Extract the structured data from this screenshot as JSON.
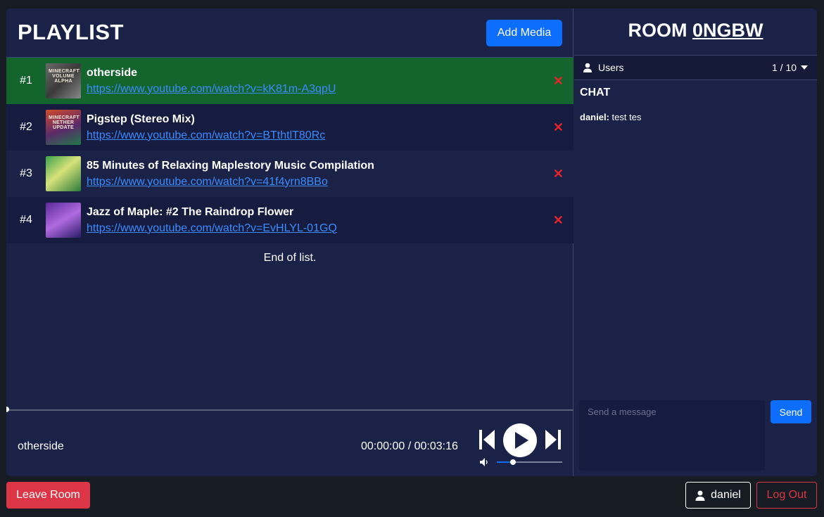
{
  "playlist": {
    "title": "PLAYLIST",
    "add_media_label": "Add Media",
    "end_text": "End of list.",
    "tracks": [
      {
        "num": "#1",
        "title": "otherside",
        "url": "https://www.youtube.com/watch?v=kK81m-A3qpU",
        "thumb_text": "MINECRAFT VOLUME ALPHA",
        "active": true
      },
      {
        "num": "#2",
        "title": "Pigstep (Stereo Mix)",
        "url": "https://www.youtube.com/watch?v=BTthtlT80Rc",
        "thumb_text": "MINECRAFT NETHER UPDATE",
        "active": false
      },
      {
        "num": "#3",
        "title": "85 Minutes of Relaxing Maplestory Music Compilation",
        "url": "https://www.youtube.com/watch?v=41f4yrn8BBo",
        "thumb_text": "",
        "active": false
      },
      {
        "num": "#4",
        "title": "Jazz of Maple: #2 The Raindrop Flower",
        "url": "https://www.youtube.com/watch?v=EvHLYL-01GQ",
        "thumb_text": "",
        "active": false
      }
    ],
    "remove_glyph": "✕"
  },
  "player": {
    "now_playing": "otherside",
    "time": "00:00:00 / 00:03:16",
    "progress": 0,
    "volume": 0.25
  },
  "room": {
    "prefix": "ROOM",
    "code": "0NGBW",
    "users_label": "Users",
    "users_count": "1 / 10",
    "chat_title": "CHAT",
    "messages": [
      {
        "user": "daniel:",
        "text": "test tes"
      }
    ],
    "input_placeholder": "Send a message",
    "send_label": "Send"
  },
  "footer": {
    "leave_label": "Leave Room",
    "username": "daniel",
    "logout_label": "Log Out"
  },
  "colors": {
    "accent": "#0d6efd",
    "danger": "#dc3545",
    "active_row": "#14652d",
    "panel": "#1b2248"
  }
}
